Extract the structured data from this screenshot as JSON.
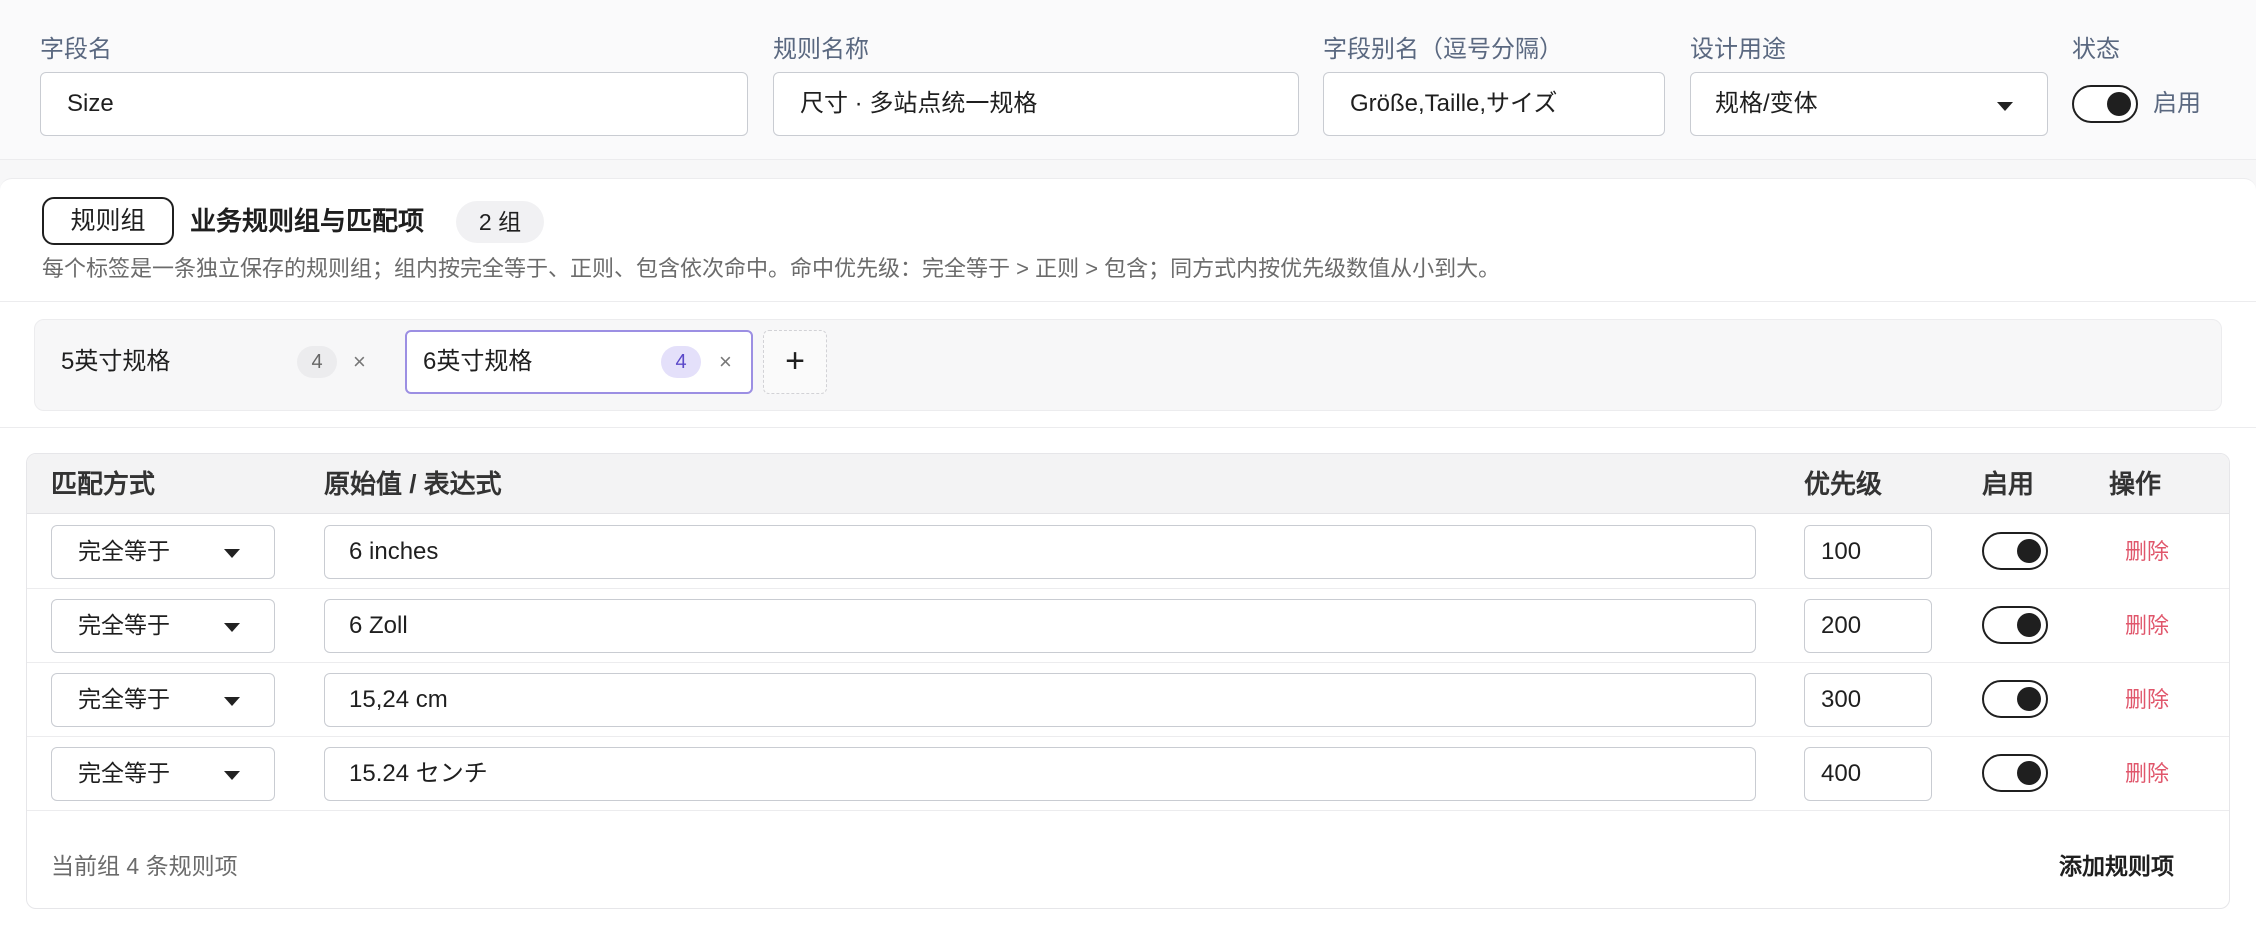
{
  "fields": {
    "name_label": "字段名",
    "name_value": "Size",
    "rule_label": "规则名称",
    "rule_value": "尺寸 · 多站点统一规格",
    "alias_label": "字段别名（逗号分隔）",
    "alias_value": "Größe,Taille,サイズ",
    "usage_label": "设计用途",
    "usage_value": "规格/变体",
    "status_label": "状态",
    "status_value": "启用"
  },
  "rules_panel": {
    "badge": "规则组",
    "title": "业务规则组与匹配项",
    "group_count": "2 组",
    "description": "每个标签是一条独立保存的规则组；组内按完全等于、正则、包含依次命中。命中优先级：完全等于 > 正则 > 包含；同方式内按优先级数值从小到大。",
    "tabs": [
      {
        "label": "5英寸规格",
        "count": "4",
        "close": "×",
        "active": false
      },
      {
        "label": "6英寸规格",
        "count": "4",
        "close": "×",
        "active": true
      }
    ],
    "add_tab": "+"
  },
  "table": {
    "headers": {
      "match": "匹配方式",
      "value": "原始值 / 表达式",
      "priority": "优先级",
      "enabled": "启用",
      "actions": "操作"
    },
    "rows": [
      {
        "match": "完全等于",
        "value": "6 inches",
        "priority": "100",
        "enabled": true,
        "action": "删除"
      },
      {
        "match": "完全等于",
        "value": "6 Zoll",
        "priority": "200",
        "enabled": true,
        "action": "删除"
      },
      {
        "match": "完全等于",
        "value": "15,24 cm",
        "priority": "300",
        "enabled": true,
        "action": "删除"
      },
      {
        "match": "完全等于",
        "value": "15.24 センチ",
        "priority": "400",
        "enabled": true,
        "action": "删除"
      }
    ],
    "footer_text": "当前组 4 条规则项",
    "add_button": "添加规则项"
  },
  "colors": {
    "accent": "#7b68d8",
    "accent_soft": "#e4e0fa",
    "danger": "#e0566b",
    "label": "#5a6880"
  },
  "icons": {
    "dropdown": "chevron-down-icon",
    "close": "close-icon",
    "add": "plus-icon"
  }
}
